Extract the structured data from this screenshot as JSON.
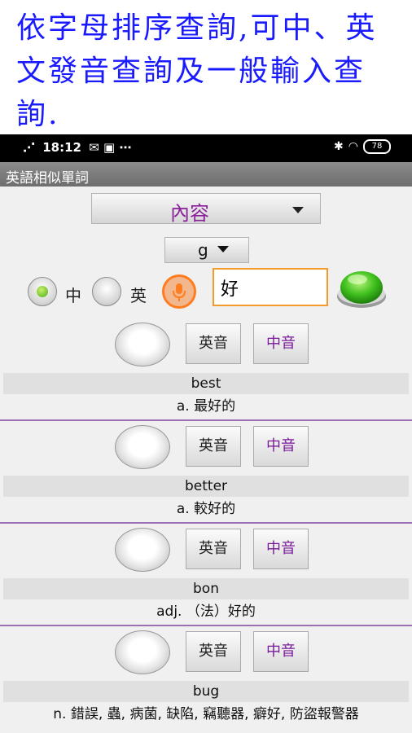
{
  "banner": {
    "text": "依字母排序查詢,可中、英文發音查詢及一般輸入查詢."
  },
  "statusbar": {
    "time": "18:12",
    "battery": "78"
  },
  "app": {
    "title": "英語相似單詞"
  },
  "controls": {
    "category_dropdown": "內容",
    "letter_dropdown": "g",
    "radio_zh_label": "中",
    "radio_en_label": "英",
    "search_value": "好"
  },
  "colors": {
    "accent_orange": "#f39c2b",
    "go_green": "#3fbf2a",
    "purple_text": "#7a1c9a"
  },
  "entries": [
    {
      "en_btn": "英音",
      "zh_btn": "中音",
      "word": "best",
      "definition": "a. 最好的"
    },
    {
      "en_btn": "英音",
      "zh_btn": "中音",
      "word": "better",
      "definition": "a. 較好的"
    },
    {
      "en_btn": "英音",
      "zh_btn": "中音",
      "word": "bon",
      "definition": "adj. （法）好的"
    },
    {
      "en_btn": "英音",
      "zh_btn": "中音",
      "word": "bug",
      "definition": "n. 錯誤, 蟲, 病菌, 缺陷, 竊聽器, 癖好, 防盜報警器"
    }
  ]
}
